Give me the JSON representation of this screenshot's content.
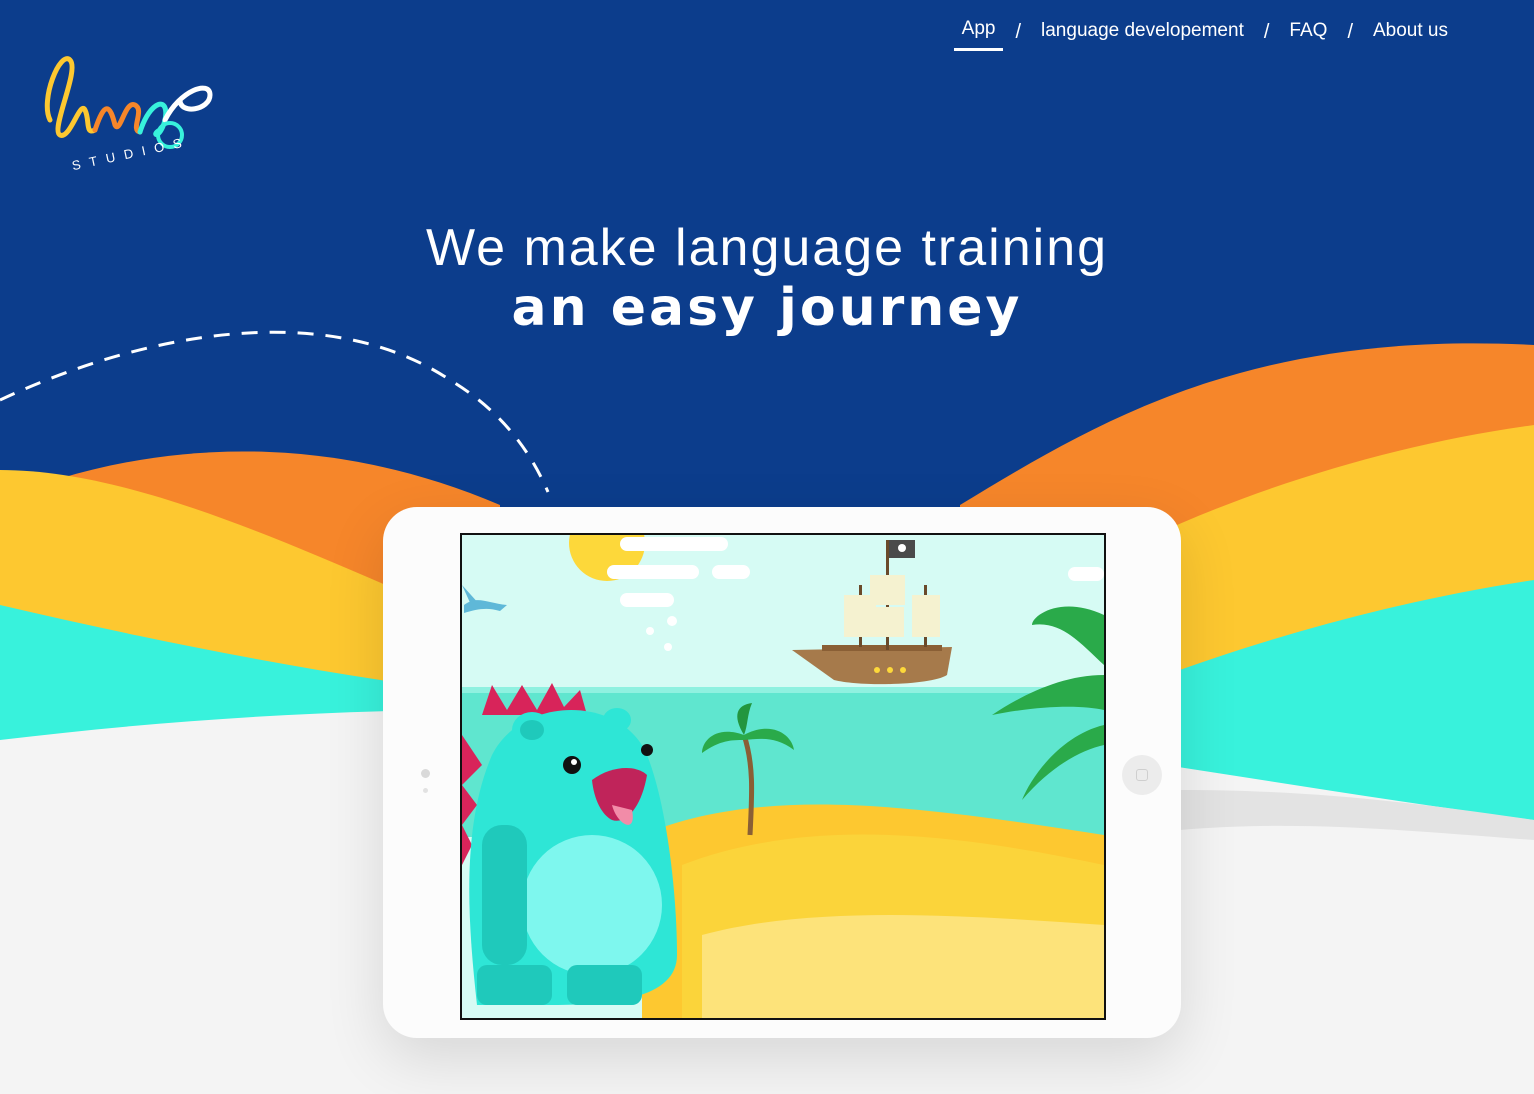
{
  "brand": {
    "logo_word": "Lingo",
    "logo_sub": "STUDIOS"
  },
  "nav": {
    "items": [
      {
        "label": "App",
        "active": true
      },
      {
        "label": "language developement",
        "active": false
      },
      {
        "label": "FAQ",
        "active": false
      },
      {
        "label": "About us",
        "active": false
      }
    ],
    "separator": "/"
  },
  "hero": {
    "line1": "We make language training",
    "line2": "an easy journey"
  },
  "colors": {
    "navy": "#0c3d8c",
    "orange": "#f6862a",
    "yellow": "#fdc830",
    "turquoise": "#38f2dc",
    "light": "#f4f4f4"
  }
}
